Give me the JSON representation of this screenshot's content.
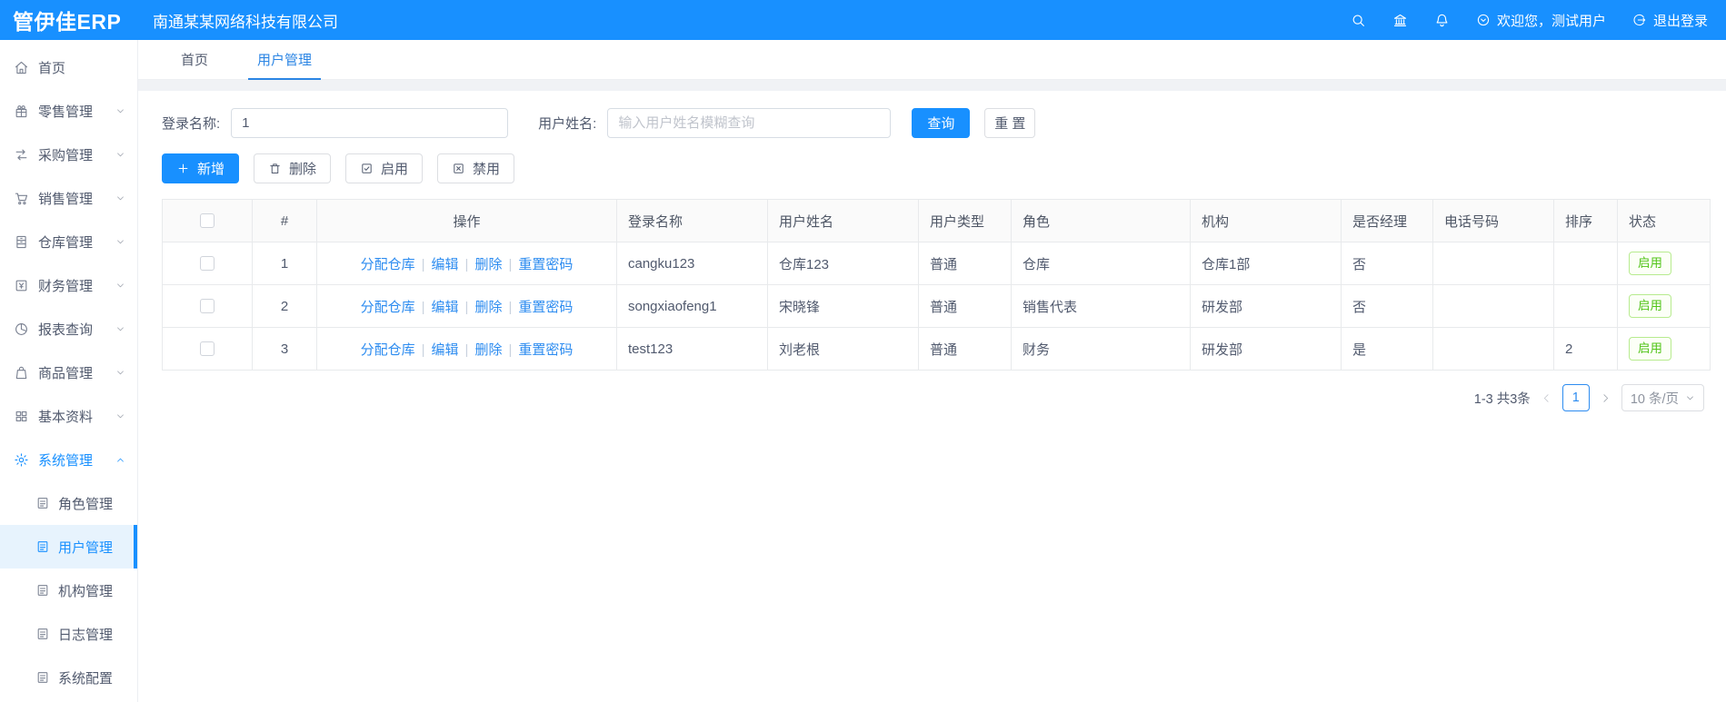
{
  "header": {
    "logo": "管伊佳ERP",
    "company": "南通某某网络科技有限公司",
    "welcome": "欢迎您，测试用户",
    "logout": "退出登录"
  },
  "sidebar": {
    "items": [
      {
        "key": "home",
        "icon": "home",
        "label": "首页",
        "expandable": false,
        "expanded": false,
        "active": false
      },
      {
        "key": "retail",
        "icon": "retail",
        "label": "零售管理",
        "expandable": true,
        "expanded": false,
        "active": false
      },
      {
        "key": "purchase",
        "icon": "purchase",
        "label": "采购管理",
        "expandable": true,
        "expanded": false,
        "active": false
      },
      {
        "key": "sales",
        "icon": "sales",
        "label": "销售管理",
        "expandable": true,
        "expanded": false,
        "active": false
      },
      {
        "key": "warehouse",
        "icon": "warehouse",
        "label": "仓库管理",
        "expandable": true,
        "expanded": false,
        "active": false
      },
      {
        "key": "finance",
        "icon": "finance",
        "label": "财务管理",
        "expandable": true,
        "expanded": false,
        "active": false
      },
      {
        "key": "report",
        "icon": "report",
        "label": "报表查询",
        "expandable": true,
        "expanded": false,
        "active": false
      },
      {
        "key": "goods",
        "icon": "goods",
        "label": "商品管理",
        "expandable": true,
        "expanded": false,
        "active": false
      },
      {
        "key": "basic",
        "icon": "basic",
        "label": "基本资料",
        "expandable": true,
        "expanded": false,
        "active": false
      },
      {
        "key": "system",
        "icon": "system",
        "label": "系统管理",
        "expandable": true,
        "expanded": true,
        "active": true
      }
    ],
    "subitems": [
      {
        "key": "role",
        "label": "角色管理",
        "active": false
      },
      {
        "key": "user",
        "label": "用户管理",
        "active": true
      },
      {
        "key": "org",
        "label": "机构管理",
        "active": false
      },
      {
        "key": "log",
        "label": "日志管理",
        "active": false
      },
      {
        "key": "config",
        "label": "系统配置",
        "active": false
      }
    ]
  },
  "tabs": [
    {
      "label": "首页",
      "active": false
    },
    {
      "label": "用户管理",
      "active": true
    }
  ],
  "search": {
    "login_label": "登录名称:",
    "login_value": "1",
    "name_label": "用户姓名:",
    "name_placeholder": "输入用户姓名模糊查询",
    "query_btn": "查询",
    "reset_btn": "重 置"
  },
  "toolbar": {
    "add": "新增",
    "delete": "删除",
    "enable": "启用",
    "disable": "禁用"
  },
  "table": {
    "headers": [
      "#",
      "操作",
      "登录名称",
      "用户姓名",
      "用户类型",
      "角色",
      "机构",
      "是否经理",
      "电话号码",
      "排序",
      "状态"
    ],
    "action_links": [
      "分配仓库",
      "编辑",
      "删除",
      "重置密码"
    ],
    "rows": [
      {
        "index": "1",
        "login": "cangku123",
        "name": "仓库123",
        "type": "普通",
        "role": "仓库",
        "org": "仓库1部",
        "manager": "否",
        "phone": "",
        "sort": "",
        "status": "启用"
      },
      {
        "index": "2",
        "login": "songxiaofeng1",
        "name": "宋晓锋",
        "type": "普通",
        "role": "销售代表",
        "org": "研发部",
        "manager": "否",
        "phone": "",
        "sort": "",
        "status": "启用"
      },
      {
        "index": "3",
        "login": "test123",
        "name": "刘老根",
        "type": "普通",
        "role": "财务",
        "org": "研发部",
        "manager": "是",
        "phone": "",
        "sort": "2",
        "status": "启用"
      }
    ]
  },
  "pagination": {
    "summary": "1-3 共3条",
    "page": "1",
    "page_size": "10 条/页"
  },
  "colors": {
    "header_bg": "#1890ff",
    "accent_blue": "#2d8cf0",
    "status_green": "#52c41a",
    "status_green_border": "#b7eb8f"
  }
}
